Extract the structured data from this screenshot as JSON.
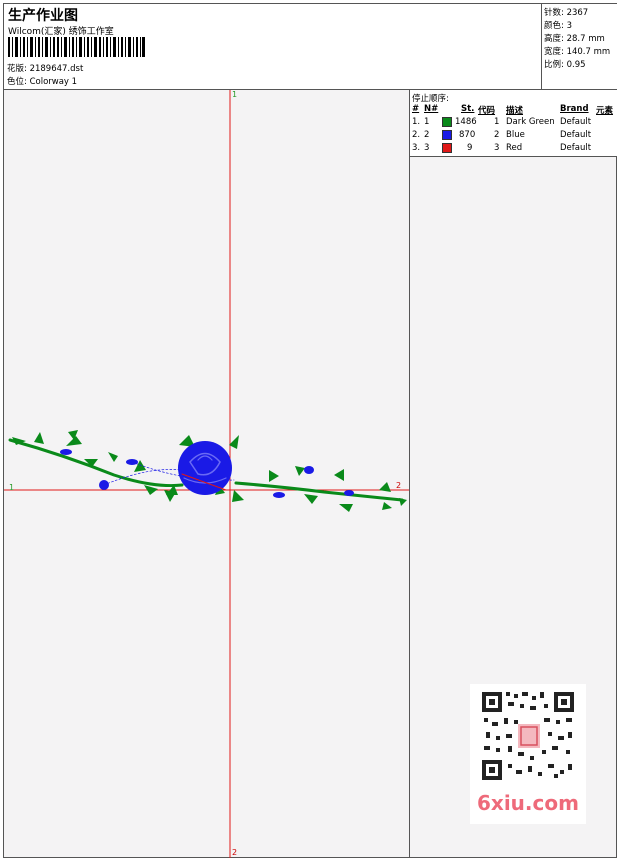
{
  "header": {
    "title": "生产作业图",
    "company": "Wilcom(汇家) 绣饰工作室",
    "design_label": "花版:",
    "design_value": "2189647.dst",
    "color_label": "色位:",
    "color_value": "Colorway 1"
  },
  "stats": [
    {
      "label": "针数:",
      "value": "2367"
    },
    {
      "label": "颜色:",
      "value": "3"
    },
    {
      "label": "高度:",
      "value": "28.7 mm"
    },
    {
      "label": "宽度:",
      "value": "140.7 mm"
    },
    {
      "label": "比例:",
      "value": "0.95"
    }
  ],
  "table": {
    "title": "停止顺序:",
    "headers": {
      "num": "#",
      "no": "N#",
      "st": "St.",
      "code": "代码",
      "desc": "描述",
      "brand": "Brand",
      "elem": "元素"
    },
    "rows": [
      {
        "num": "1.",
        "no": "1",
        "color": "#0a8a1a",
        "st": "1486",
        "code": "1",
        "desc": "Dark Green",
        "brand": "Default"
      },
      {
        "num": "2.",
        "no": "2",
        "color": "#1a1ae6",
        "st": "870",
        "code": "2",
        "desc": "Blue",
        "brand": "Default"
      },
      {
        "num": "3.",
        "no": "3",
        "color": "#e01818",
        "st": "9",
        "code": "3",
        "desc": "Red",
        "brand": "Default"
      }
    ]
  },
  "axes": {
    "top": "1",
    "bottom": "2",
    "left": "1",
    "right": "2"
  },
  "watermark": "6xiu.com",
  "colors": {
    "green": "#0a8a1a",
    "blue": "#1a1ae6",
    "red": "#e01818"
  }
}
